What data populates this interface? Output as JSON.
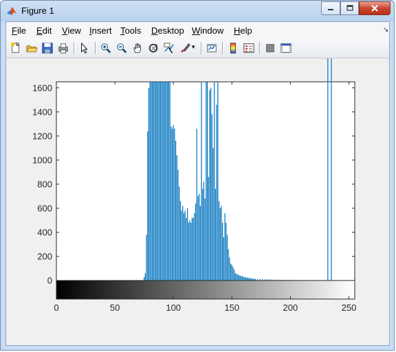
{
  "window": {
    "title": "Figure 1"
  },
  "menu": [
    {
      "id": "file",
      "u": "F",
      "rest": "ile"
    },
    {
      "id": "edit",
      "u": "E",
      "rest": "dit"
    },
    {
      "id": "view",
      "u": "V",
      "rest": "iew"
    },
    {
      "id": "insert",
      "u": "I",
      "rest": "nsert"
    },
    {
      "id": "tools",
      "u": "T",
      "rest": "ools"
    },
    {
      "id": "desktop",
      "u": "D",
      "rest": "esktop"
    },
    {
      "id": "window",
      "u": "W",
      "rest": "indow"
    },
    {
      "id": "help",
      "u": "H",
      "rest": "elp"
    }
  ],
  "toolbar": [
    "new-figure-icon",
    "open-file-icon",
    "save-icon",
    "print-icon",
    "|",
    "edit-plot-arrow-icon",
    "|",
    "zoom-in-icon",
    "zoom-out-icon",
    "pan-hand-icon",
    "rotate-3d-icon",
    "data-cursor-icon",
    "brush-icon",
    "|",
    "link-plot-icon",
    "|",
    "insert-colorbar-icon",
    "insert-legend-icon",
    "|",
    "hide-plot-tools-icon",
    "show-plot-tools-icon"
  ],
  "chart_data": {
    "type": "bar",
    "title": "",
    "xlabel": "",
    "ylabel": "",
    "xlim": [
      0,
      255
    ],
    "ylim": [
      0,
      1650
    ],
    "xticks": [
      0,
      50,
      100,
      150,
      200,
      250
    ],
    "yticks": [
      0,
      200,
      400,
      600,
      800,
      1000,
      1200,
      1400,
      1600
    ],
    "colorbar": "grayscale 0-255 below x-axis",
    "bar_color": "#0072bd",
    "x": [
      75,
      76,
      77,
      78,
      79,
      80,
      81,
      82,
      83,
      84,
      85,
      86,
      87,
      88,
      89,
      90,
      91,
      92,
      93,
      94,
      95,
      96,
      97,
      98,
      99,
      100,
      101,
      102,
      103,
      104,
      105,
      106,
      107,
      108,
      109,
      110,
      111,
      112,
      113,
      114,
      115,
      116,
      117,
      118,
      119,
      120,
      121,
      122,
      123,
      124,
      125,
      126,
      127,
      128,
      129,
      130,
      131,
      132,
      133,
      134,
      135,
      136,
      137,
      138,
      139,
      140,
      141,
      142,
      143,
      144,
      145,
      146,
      147,
      148,
      149,
      150,
      151,
      152,
      153,
      154,
      155,
      156,
      157,
      158,
      159,
      160,
      161,
      162,
      163,
      164,
      165,
      166,
      167,
      168,
      169,
      170,
      172,
      174,
      176,
      178,
      180,
      182,
      184,
      186,
      188,
      190,
      192,
      195,
      198,
      200,
      202,
      205,
      208,
      210,
      212,
      215,
      218,
      220,
      222,
      225,
      228,
      230,
      232,
      235
    ],
    "values": [
      30,
      60,
      380,
      1240,
      1600,
      1650,
      1650,
      1650,
      1650,
      1650,
      1650,
      1650,
      1650,
      1650,
      1650,
      1650,
      1650,
      1650,
      1650,
      1650,
      1650,
      1650,
      1650,
      1280,
      1260,
      1290,
      1260,
      1160,
      1040,
      920,
      780,
      660,
      580,
      620,
      560,
      580,
      520,
      600,
      480,
      500,
      480,
      520,
      520,
      560,
      640,
      1260,
      700,
      720,
      620,
      1650,
      760,
      820,
      680,
      1650,
      1650,
      860,
      1580,
      1600,
      1380,
      1100,
      1650,
      760,
      1460,
      1650,
      660,
      600,
      620,
      480,
      360,
      560,
      480,
      380,
      260,
      190,
      140,
      130,
      110,
      90,
      60,
      55,
      50,
      45,
      40,
      38,
      35,
      30,
      28,
      26,
      24,
      22,
      20,
      18,
      16,
      15,
      14,
      13,
      12,
      11,
      10,
      10,
      9,
      9,
      8,
      8,
      7,
      7,
      6,
      6,
      5,
      5,
      5,
      4,
      4,
      4,
      3,
      3,
      3,
      3,
      2,
      2,
      2,
      2
    ]
  }
}
